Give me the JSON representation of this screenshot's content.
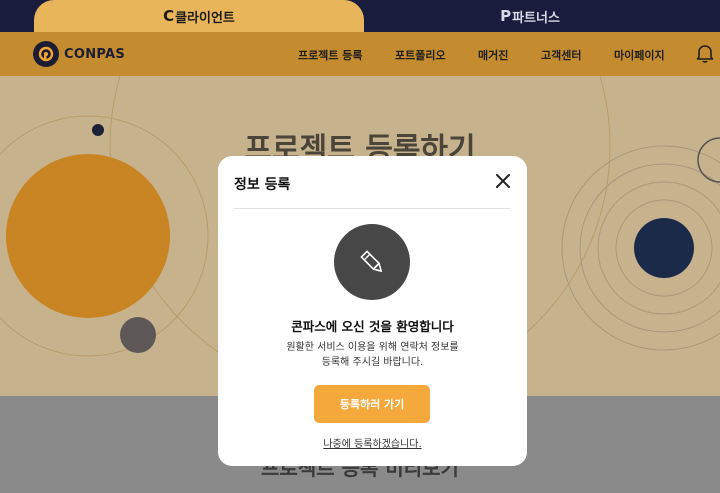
{
  "tabs": {
    "client": "클라이언트",
    "partner": "파트너스"
  },
  "brand": {
    "name": "CONPAS"
  },
  "nav": {
    "items": [
      "프로젝트 등록",
      "포트폴리오",
      "매거진",
      "고객센터",
      "마이페이지"
    ]
  },
  "hero": {
    "title": "프로젝트 등록하기",
    "lower_title": "프로젝트 등록 미리보기"
  },
  "modal": {
    "title": "정보 등록",
    "welcome": "콘파스에 오신 것을 환영합니다",
    "desc_line1": "원활한 서비스 이용을 위해 연락처 정보를",
    "desc_line2": "등록해 주시길 바랍니다.",
    "primary_button": "등록하러 가기",
    "later_link": "나중에 등록하겠습니다."
  },
  "colors": {
    "top_bar": "#191c3c",
    "nav_bar": "#c48c2e",
    "accent": "#f5a83b",
    "hero_bg": "#c7b28e",
    "orange_planet": "#d08a24",
    "navy_planet": "#1c2a4a"
  },
  "icons": [
    "bell-icon",
    "close-icon",
    "pencil-icon",
    "logo-icon"
  ]
}
